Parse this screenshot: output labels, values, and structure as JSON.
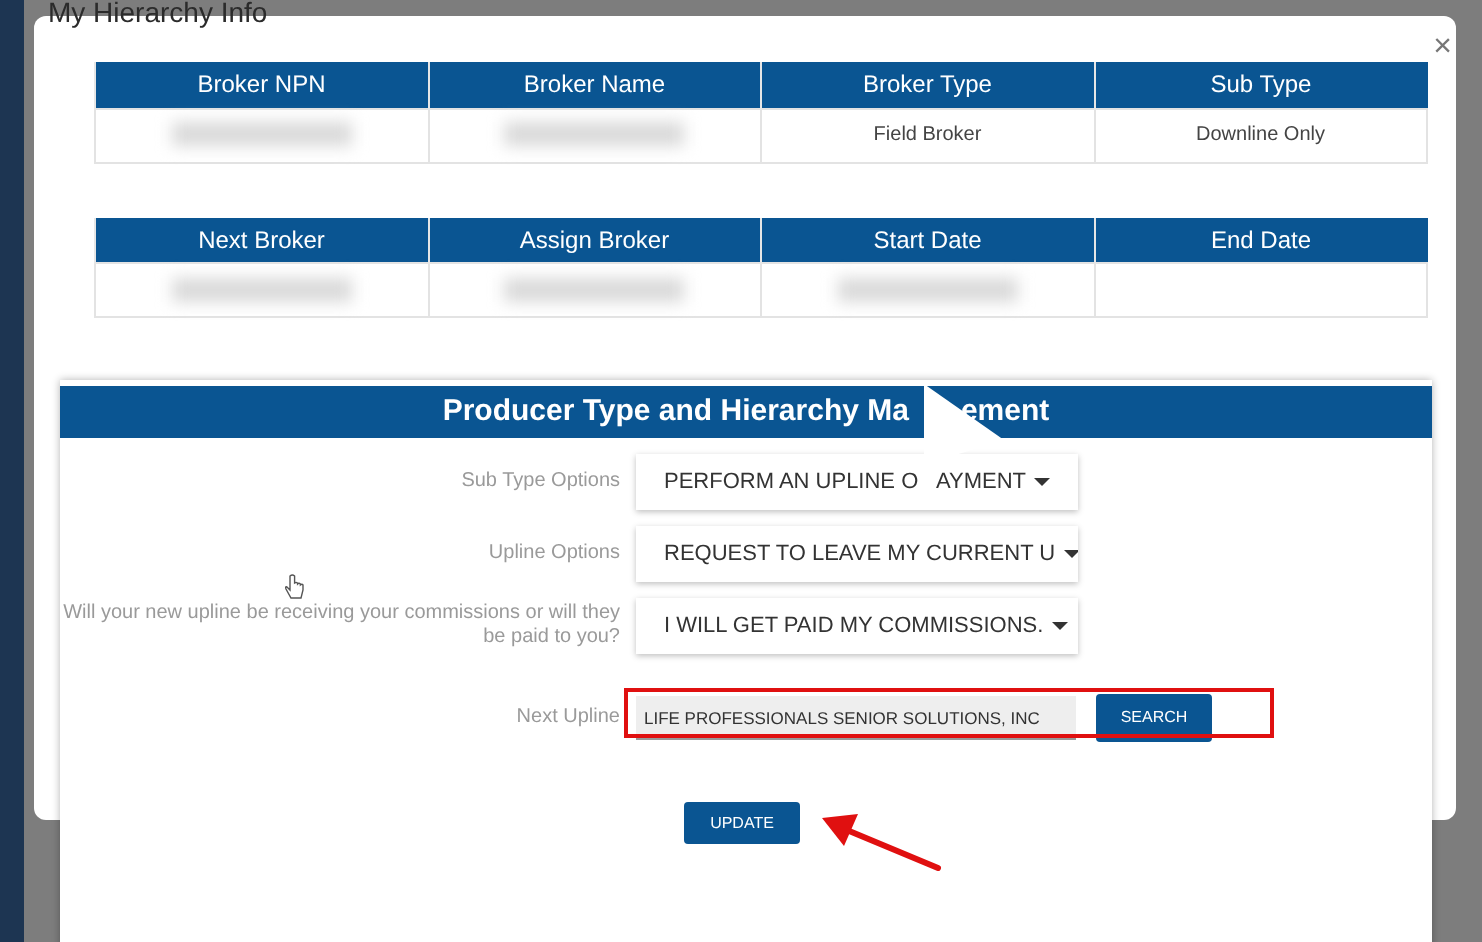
{
  "background": {
    "title": "My Hierarchy Info"
  },
  "dialog": {
    "close": "×",
    "tables": [
      {
        "columns": [
          "Broker NPN",
          "Broker Name",
          "Broker Type",
          "Sub Type"
        ],
        "row": [
          {
            "blurred": true
          },
          {
            "blurred": true
          },
          {
            "text": "Field Broker",
            "blurred": false
          },
          {
            "text": "Downline Only",
            "blurred": false
          }
        ]
      },
      {
        "columns": [
          "Next Broker",
          "Assign Broker",
          "Start Date",
          "End Date"
        ],
        "row": [
          {
            "blurred": true
          },
          {
            "blurred": true
          },
          {
            "blurred": true
          },
          {
            "blurred": false
          }
        ]
      }
    ]
  },
  "panel": {
    "title_parts": [
      "Producer Type and Hierarchy Ma",
      "ement"
    ],
    "fields": [
      {
        "kind": "select",
        "label": "Sub Type Options",
        "value_parts": [
          "PERFORM AN UPLINE O",
          "AYMENT"
        ]
      },
      {
        "kind": "select",
        "label": "Upline Options",
        "value_parts": [
          "REQUEST TO LEAVE MY CURRENT U"
        ]
      },
      {
        "kind": "select",
        "label": "Will your new upline be receiving your commissions or will they be paid to you?",
        "value_parts": [
          "I WILL GET PAID MY COMMISSIONS."
        ]
      },
      {
        "kind": "search",
        "label": "Next Upline",
        "value": "LIFE PROFESSIONALS SENIOR SOLUTIONS, INC",
        "button": "SEARCH",
        "highlighted": true
      }
    ],
    "submit": "UPDATE"
  }
}
